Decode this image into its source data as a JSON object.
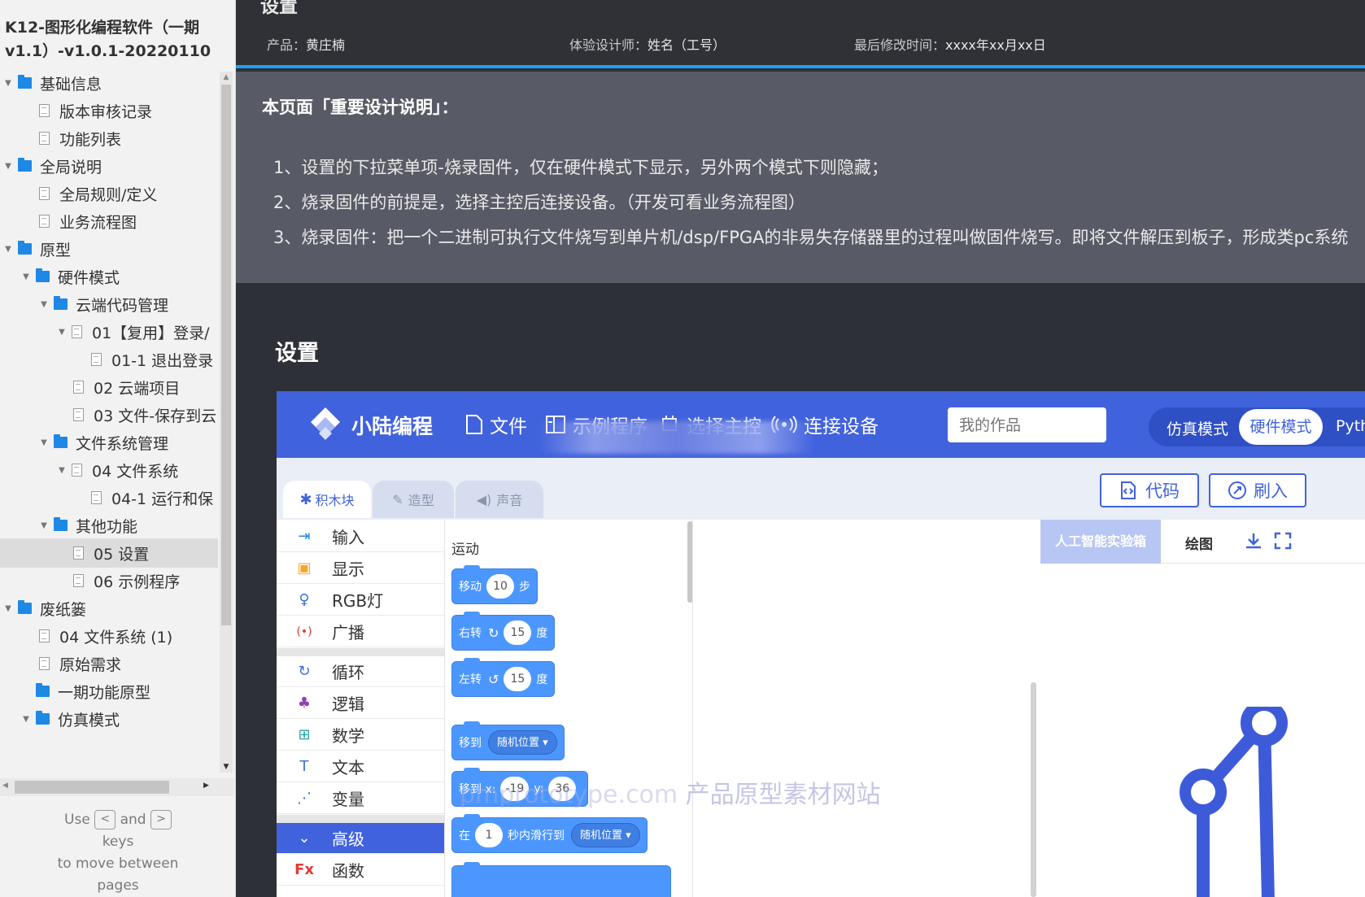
{
  "sidebar": {
    "project_title": "K12-图形化编程软件（一期v1.1）-v1.0.1-20220110",
    "tree": [
      {
        "label": "基础信息",
        "type": "folder",
        "expanded": true
      },
      {
        "label": "版本审核记录",
        "type": "page"
      },
      {
        "label": "功能列表",
        "type": "page"
      },
      {
        "label": "全局说明",
        "type": "folder",
        "expanded": true
      },
      {
        "label": "全局规则/定义",
        "type": "page"
      },
      {
        "label": "业务流程图",
        "type": "page"
      },
      {
        "label": "原型",
        "type": "folder",
        "expanded": true
      },
      {
        "label": "硬件模式",
        "type": "folder",
        "expanded": true
      },
      {
        "label": "云端代码管理",
        "type": "folder",
        "expanded": true
      },
      {
        "label": "01【复用】登录/",
        "type": "page",
        "expanded": true
      },
      {
        "label": "01-1 退出登录",
        "type": "page"
      },
      {
        "label": "02 云端项目",
        "type": "page"
      },
      {
        "label": "03 文件-保存到云",
        "type": "page"
      },
      {
        "label": "文件系统管理",
        "type": "folder",
        "expanded": true
      },
      {
        "label": "04 文件系统",
        "type": "page",
        "expanded": true
      },
      {
        "label": "04-1 运行和保",
        "type": "page"
      },
      {
        "label": "其他功能",
        "type": "folder",
        "expanded": true
      },
      {
        "label": "05 设置",
        "type": "page",
        "selected": true
      },
      {
        "label": "06 示例程序",
        "type": "page"
      },
      {
        "label": "废纸篓",
        "type": "folder",
        "expanded": true
      },
      {
        "label": "04 文件系统 (1)",
        "type": "page"
      },
      {
        "label": "原始需求",
        "type": "page"
      },
      {
        "label": "一期功能原型",
        "type": "folder"
      },
      {
        "label": "仿真模式",
        "type": "folder",
        "expanded": true
      }
    ],
    "nav_hint": {
      "use": "Use",
      "prev_key": "<",
      "and": "and",
      "next_key": ">",
      "keys": "keys",
      "line3": "to move between",
      "line4": "pages"
    }
  },
  "doc": {
    "top_title": "设置",
    "product_label": "产品：",
    "product_value": "黄庄楠",
    "designer_label": "体验设计师：",
    "designer_value": "姓名（工号）",
    "modified_label": "最后修改时间：",
    "modified_value": "xxxx年xx月xx日",
    "notes_heading": "本页面「重要设计说明」：",
    "notes": [
      "1、设置的下拉菜单项-烧录固件，仅在硬件模式下显示，另外两个模式下则隐藏；",
      "2、烧录固件的前提是，选择主控后连接设备。（开发可看业务流程图）",
      "3、烧录固件：把一个二进制可执行文件烧写到单片机/dsp/FPGA的非易失存储器里的过程叫做固件烧写。即将文件解压到板子，形成类pc系统"
    ],
    "section_title": "设置"
  },
  "ide": {
    "logo_text": "小陆编程",
    "menu": {
      "file": "文件",
      "examples": "示例程序",
      "control": "选择主控",
      "connect": "连接设备"
    },
    "works_placeholder": "我的作品",
    "modes": {
      "sim": "仿真模式",
      "hardware": "硬件模式",
      "python": "Python"
    },
    "tabs": {
      "blocks": "积木块",
      "costume": "造型",
      "sound": "声音"
    },
    "buttons": {
      "code": "代码",
      "flash": "刷入"
    },
    "categories": [
      {
        "label": "输入",
        "icon": "input-icon"
      },
      {
        "label": "显示",
        "icon": "display-icon"
      },
      {
        "label": "RGB灯",
        "icon": "bulb-icon"
      },
      {
        "label": "广播",
        "icon": "broadcast-icon"
      },
      {
        "label": "循环",
        "icon": "loop-icon"
      },
      {
        "label": "逻辑",
        "icon": "logic-icon"
      },
      {
        "label": "数学",
        "icon": "math-icon"
      },
      {
        "label": "文本",
        "icon": "text-icon"
      },
      {
        "label": "变量",
        "icon": "variable-icon"
      },
      {
        "label": "高级",
        "icon": "chevron-down-icon",
        "active": true
      },
      {
        "label": "函数",
        "icon": "function-icon"
      }
    ],
    "palette": {
      "heading": "运动",
      "move_label": "移动",
      "move_steps": "10",
      "move_unit": "步",
      "turn_right_label": "右转",
      "turn_right_value": "15",
      "turn_left_label": "左转",
      "turn_left_value": "15",
      "degree_unit": "度",
      "goto_label": "移到",
      "goto_target": "随机位置",
      "gotoxy_label": "移到 x:",
      "gotoxy_x": "-19",
      "gotoxy_y_label": "y:",
      "gotoxy_y": "36",
      "glide_prefix": "在",
      "glide_seconds": "1",
      "glide_mid": "秒内滑行到",
      "glide_target": "随机位置"
    },
    "stage": {
      "ai_tab": "人工智能实验箱",
      "draw_tab": "绘图"
    },
    "colors": {
      "brand": "#4162dd",
      "block": "#4c97ff"
    }
  },
  "watermark": {
    "en": "pmprototype.com",
    "cn": "产品原型素材网站"
  }
}
